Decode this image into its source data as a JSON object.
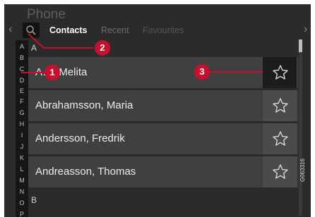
{
  "app": {
    "title": "Phone"
  },
  "nav": {
    "left_arrow": "‹",
    "right_arrow": "›"
  },
  "tabs": [
    {
      "label": "Contacts",
      "active": true
    },
    {
      "label": "Recent",
      "active": false
    },
    {
      "label": "Favourites",
      "active": false
    }
  ],
  "search": {
    "icon": "search-icon"
  },
  "alphabet": [
    "A",
    "B",
    "C",
    "D",
    "E",
    "F",
    "G",
    "H",
    "I",
    "J",
    "K",
    "L",
    "M",
    "N",
    "O",
    "P"
  ],
  "sections": [
    {
      "letter": "A"
    },
    {
      "letter": "B"
    }
  ],
  "contacts": [
    {
      "name": "A…, Melita",
      "favourite_selected": true
    },
    {
      "name": "Abrahamsson, Maria",
      "favourite_selected": false
    },
    {
      "name": "Andersson, Fredrik",
      "favourite_selected": false
    },
    {
      "name": "Andreasson, Thomas",
      "favourite_selected": false
    }
  ],
  "callouts": [
    "1",
    "2",
    "3"
  ],
  "figure_code": "G063316",
  "colors": {
    "callout": "#c8102e",
    "background": "#2b2b2b",
    "row": "#404040"
  }
}
